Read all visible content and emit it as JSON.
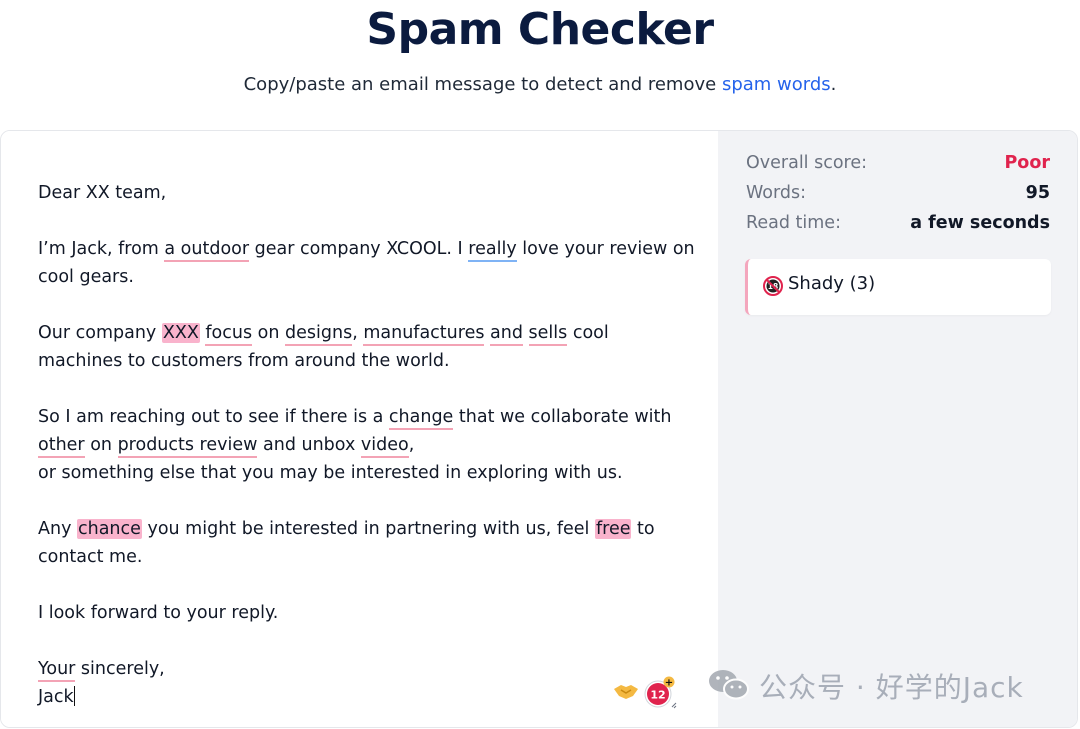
{
  "header": {
    "title": "Spam Checker",
    "subtitle_text": "Copy/paste an email message to detect and remove",
    "subtitle_link": "spam words",
    "subtitle_end": "."
  },
  "email": {
    "greeting": "Dear XX team,",
    "p1": {
      "a": "I’m Jack, from ",
      "b": "a outdoor",
      "c": " gear company XCOOL. I ",
      "d": "really",
      "e": " love your review on cool gears."
    },
    "p2": {
      "a": "Our company ",
      "b": "XXX",
      "c": " ",
      "d": "focus",
      "e": " on ",
      "f": "designs",
      "g": ", ",
      "h": "manufactures",
      "i": " ",
      "j": "and",
      "k": " ",
      "l": "sells",
      "m": " cool machines to customers from around the world."
    },
    "p3": {
      "a": "So I am reaching out to see if there is a ",
      "b": "change",
      "c": " that we collaborate with ",
      "d": "other",
      "e": " on ",
      "f": "products review",
      "g": " and unbox ",
      "h": "video",
      "i": ",",
      "j": "or something else that you may be interested in exploring with us."
    },
    "p4": {
      "a": "Any ",
      "b": "chance",
      "c": " you might be interested in partnering with us, feel ",
      "d": "free",
      "e": " to contact me."
    },
    "p5": "I look forward to your reply.",
    "closing_a": "Your",
    "closing_b": " sincerely,",
    "signature": "Jack"
  },
  "icons": {
    "handshake": "handshake-icon",
    "badge": "score-badge-icon",
    "badge_number": "12",
    "badge_plus": "+"
  },
  "sidebar": {
    "stats": [
      {
        "label": "Overall score:",
        "value": "Poor"
      },
      {
        "label": "Words:",
        "value": "95"
      },
      {
        "label": "Read time:",
        "value": "a few seconds"
      }
    ],
    "category": {
      "icon": "18-restricted-icon",
      "icon_text": "18",
      "label": "Shady (3)"
    }
  },
  "watermark": {
    "icon": "wechat-icon",
    "text": "公众号 · 好学的Jack"
  },
  "colors": {
    "title": "#0b1b3f",
    "link": "#2563eb",
    "poor": "#e0234d",
    "underline_red": "#f3a3b5",
    "underline_blue": "#7fb3f5",
    "highlight": "#f9b3cc",
    "sidebar_bg": "#f2f3f6"
  }
}
